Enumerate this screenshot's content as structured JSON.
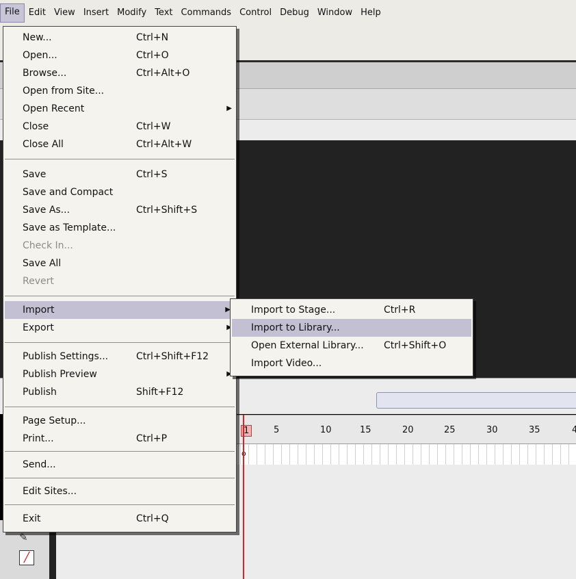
{
  "menubar": {
    "items": [
      "File",
      "Edit",
      "View",
      "Insert",
      "Modify",
      "Text",
      "Commands",
      "Control",
      "Debug",
      "Window",
      "Help"
    ]
  },
  "file_menu": {
    "items": [
      {
        "label": "New...",
        "shortcut": "Ctrl+N"
      },
      {
        "label": "Open...",
        "shortcut": "Ctrl+O"
      },
      {
        "label": "Browse...",
        "shortcut": "Ctrl+Alt+O"
      },
      {
        "label": "Open from Site..."
      },
      {
        "label": "Open Recent",
        "submenu": true
      },
      {
        "label": "Close",
        "shortcut": "Ctrl+W"
      },
      {
        "label": "Close All",
        "shortcut": "Ctrl+Alt+W"
      },
      {
        "label": "Save",
        "shortcut": "Ctrl+S"
      },
      {
        "label": "Save and Compact"
      },
      {
        "label": "Save As...",
        "shortcut": "Ctrl+Shift+S"
      },
      {
        "label": "Save as Template..."
      },
      {
        "label": "Check In...",
        "disabled": true
      },
      {
        "label": "Save All"
      },
      {
        "label": "Revert",
        "disabled": true
      },
      {
        "label": "Import",
        "submenu": true,
        "highlighted": true
      },
      {
        "label": "Export",
        "submenu": true
      },
      {
        "label": "Publish Settings...",
        "shortcut": "Ctrl+Shift+F12"
      },
      {
        "label": "Publish Preview",
        "submenu": true
      },
      {
        "label": "Publish",
        "shortcut": "Shift+F12"
      },
      {
        "label": "Page Setup..."
      },
      {
        "label": "Print...",
        "shortcut": "Ctrl+P"
      },
      {
        "label": "Send..."
      },
      {
        "label": "Edit Sites..."
      },
      {
        "label": "Exit",
        "shortcut": "Ctrl+Q"
      }
    ]
  },
  "import_submenu": {
    "items": [
      {
        "label": "Import to Stage...",
        "shortcut": "Ctrl+R"
      },
      {
        "label": "Import to Library...",
        "highlighted": true
      },
      {
        "label": "Open External Library...",
        "shortcut": "Ctrl+Shift+O"
      },
      {
        "label": "Import Video..."
      }
    ]
  },
  "timeline": {
    "frame_numbers": [
      "1",
      "5",
      "10",
      "15",
      "20",
      "25",
      "30",
      "35",
      "4"
    ]
  },
  "colors": {
    "menu_bg": "#f4f3ee",
    "highlight": "#c3c0d4",
    "stage_bg": "#222222",
    "playhead": "#dd2222"
  }
}
